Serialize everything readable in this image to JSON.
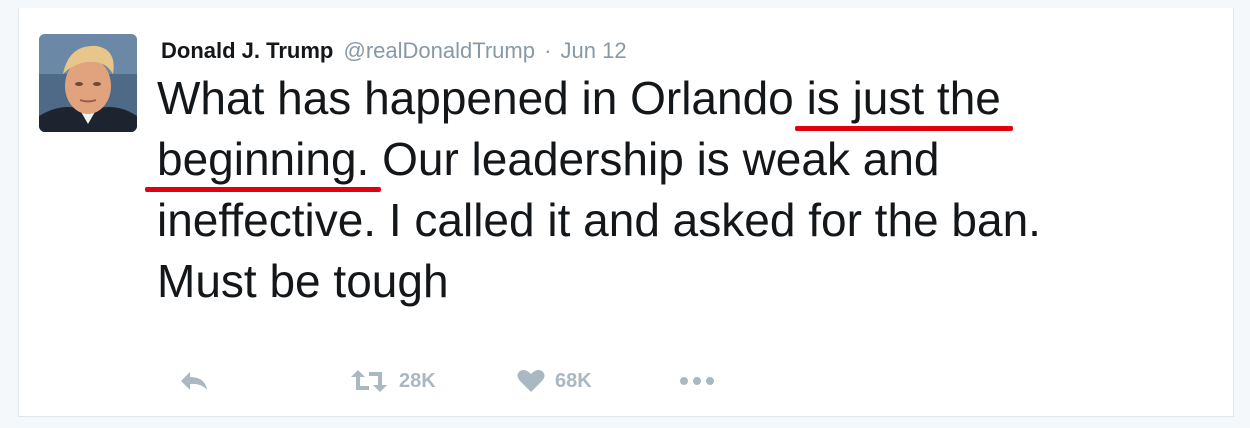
{
  "tweet": {
    "author_name": "Donald J. Trump",
    "handle": "@realDonaldTrump",
    "separator": "·",
    "date": "Jun 12",
    "lines": {
      "l1_plain": "What has happened in Orlando ",
      "l1_underlined": "is just the",
      "l2_underlined": "beginning.",
      "l2_plain": " Our leadership is weak and",
      "l3": "ineffective. I called it and asked for the ban.",
      "l4": "Must be tough"
    }
  },
  "actions": {
    "reply_icon": "reply-arrow-icon",
    "retweet_icon": "retweet-icon",
    "retweet_count": "28K",
    "like_icon": "heart-icon",
    "like_count": "68K",
    "more_icon": "more-dots-icon"
  },
  "colors": {
    "annotation_underline": "#e0000f",
    "action_icon": "#aab8c2",
    "text": "#14171a",
    "meta": "#8899a6"
  }
}
